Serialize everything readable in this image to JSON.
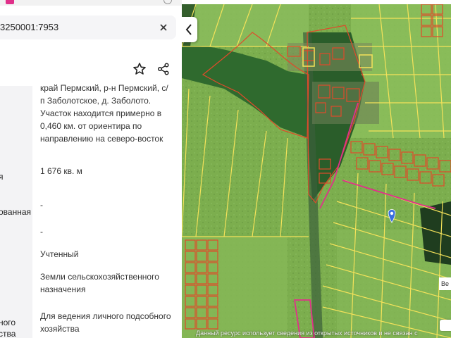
{
  "parcel": {
    "cadastral_number_fragment": "3250001:7953"
  },
  "properties": [
    {
      "label": "",
      "value": "край Пермский, р-н Пермский, с/ п Заболотское, д. Заболото. Участок находится примерно в 0,460 км. от ориентира по направлению на северо-восток"
    },
    {
      "label": "я",
      "value": "1 676 кв. м"
    },
    {
      "label": "ованная",
      "value": "-"
    },
    {
      "label": "",
      "value": "-"
    },
    {
      "label": "",
      "value": "Учтенный"
    },
    {
      "label": "",
      "value": "Земли сельскохозяйственного назначения"
    },
    {
      "label": "ного\nства",
      "value": "Для ведения личного подсобного хозяйства"
    }
  ],
  "map": {
    "attribution": "Данный ресурс использует сведения из открытых источников и не связан с",
    "scale_label": "Ве",
    "colors": {
      "parcel_border": "#f4e25a",
      "selected_border": "#e04a2a",
      "highlight": "#e0308a"
    }
  },
  "icons": {
    "close": "close-icon",
    "star": "star-icon",
    "share": "share-icon",
    "collapse": "chevron-left-icon",
    "location": "location-pin-icon"
  }
}
